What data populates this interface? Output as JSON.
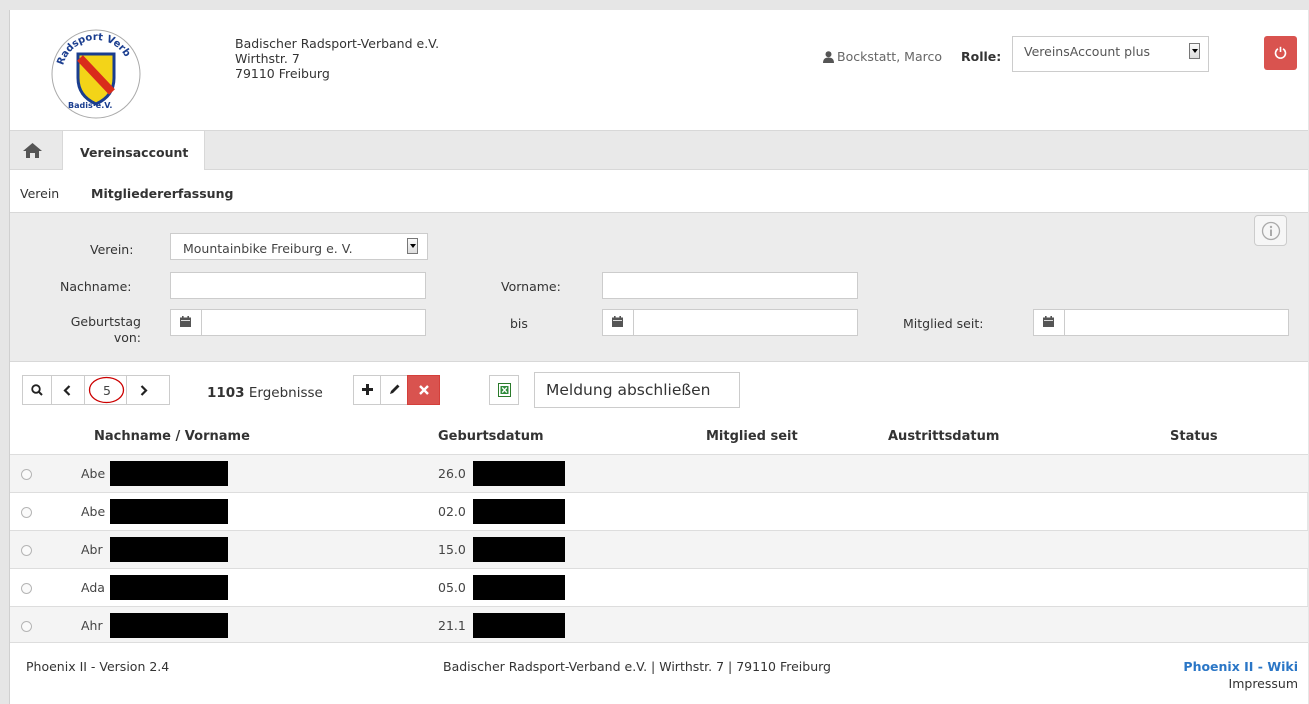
{
  "header": {
    "org_name": "Badischer Radsport-Verband e.V.",
    "street": "Wirthstr. 7",
    "city": "79110 Freiburg",
    "user": "Bockstatt, Marco",
    "role_label": "Rolle:",
    "role_value": "VereinsAccount plus",
    "logo_text": "Radsport Verband"
  },
  "nav": {
    "active_tab": "Vereinsaccount"
  },
  "subnav": {
    "items": [
      "Verein",
      "Mitgliedererfassung"
    ]
  },
  "filter": {
    "verein_label": "Verein:",
    "verein_value": "Mountainbike Freiburg e. V.",
    "nachname_label": "Nachname:",
    "vorname_label": "Vorname:",
    "geburtstag_von_label": "Geburtstag von:",
    "bis_label": "bis",
    "mitglied_seit_label": "Mitglied seit:"
  },
  "toolbar": {
    "page": "5",
    "results_count": "1103",
    "results_label": "Ergebnisse",
    "meldung_label": "Meldung abschließen"
  },
  "table": {
    "columns": [
      "Nachname / Vorname",
      "Geburtsdatum",
      "Mitglied seit",
      "Austrittsdatum",
      "Status"
    ],
    "rows": [
      {
        "name": "Abe",
        "geburtsdatum": "26.0"
      },
      {
        "name": "Abe",
        "geburtsdatum": "02.0"
      },
      {
        "name": "Abr",
        "geburtsdatum": "15.0"
      },
      {
        "name": "Ada",
        "geburtsdatum": "05.0"
      },
      {
        "name": "Ahr",
        "geburtsdatum": "21.1"
      }
    ]
  },
  "footer": {
    "version": "Phoenix II - Version 2.4",
    "address": "Badischer Radsport-Verband e.V. | Wirthstr. 7 | 79110 Freiburg",
    "wiki": "Phoenix II - Wiki",
    "impressum": "Impressum"
  },
  "colors": {
    "logout": "#d9534f",
    "delete": "#d9534f",
    "wiki_link": "#2a76c6",
    "page_circle": "#cc0000"
  }
}
